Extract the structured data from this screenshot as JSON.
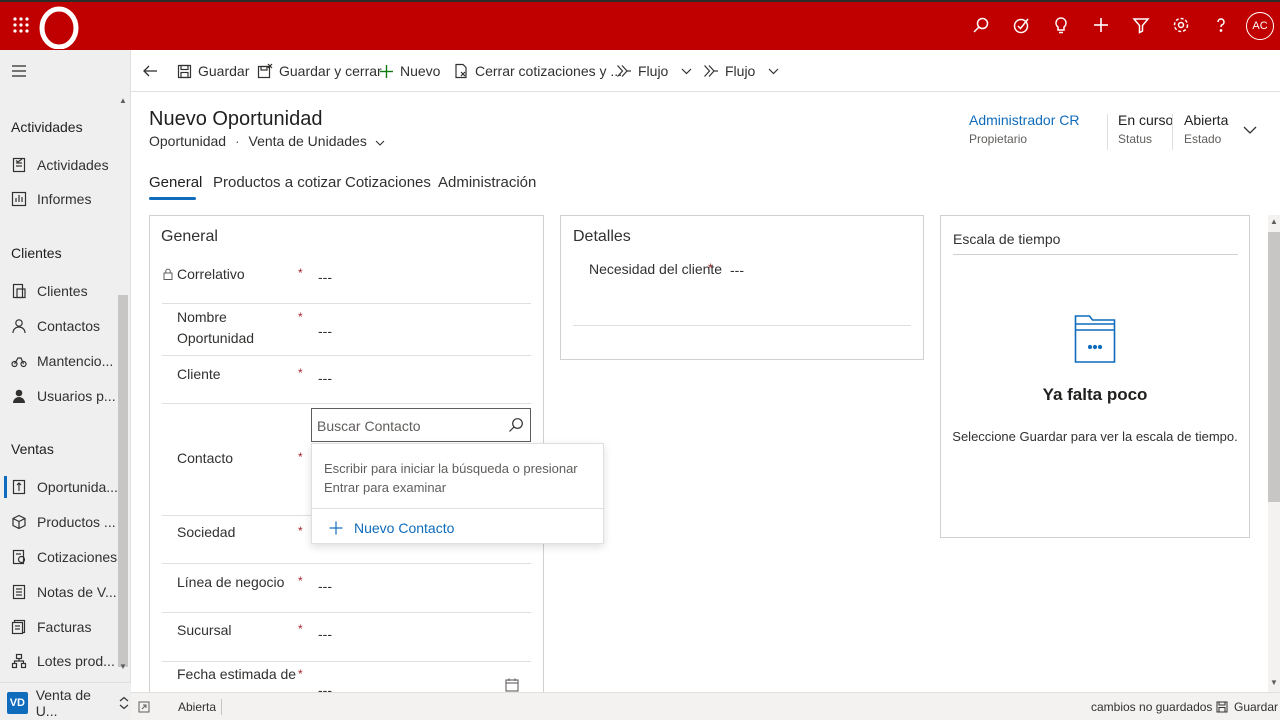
{
  "topbar": {
    "bg": "#c00000",
    "icons": [
      "search-icon",
      "task-icon",
      "lightbulb-icon",
      "plus-icon",
      "filter-icon",
      "gear-icon",
      "help-icon"
    ],
    "avatar_initials": "AC"
  },
  "nav": {
    "groups": [
      {
        "title": "Actividades",
        "items": [
          {
            "label": "Actividades",
            "icon": "activities-icon"
          },
          {
            "label": "Informes",
            "icon": "reports-icon"
          }
        ]
      },
      {
        "title": "Clientes",
        "items": [
          {
            "label": "Clientes",
            "icon": "accounts-icon"
          },
          {
            "label": "Contactos",
            "icon": "contacts-icon"
          },
          {
            "label": "Mantencio...",
            "icon": "maintenance-icon"
          },
          {
            "label": "Usuarios p...",
            "icon": "user-icon"
          }
        ]
      },
      {
        "title": "Ventas",
        "items": [
          {
            "label": "Oportunida...",
            "icon": "opportunity-icon",
            "active": true
          },
          {
            "label": "Productos ...",
            "icon": "products-icon"
          },
          {
            "label": "Cotizaciones",
            "icon": "quotes-icon"
          },
          {
            "label": "Notas de V...",
            "icon": "sales-notes-icon"
          },
          {
            "label": "Facturas",
            "icon": "invoices-icon"
          },
          {
            "label": "Lotes prod...",
            "icon": "batches-icon"
          }
        ]
      }
    ],
    "area": {
      "badge": "VD",
      "label": "Venta de U..."
    }
  },
  "commandbar": {
    "save": "Guardar",
    "save_close": "Guardar y cerrar",
    "new": "Nuevo",
    "close_quotes": "Cerrar cotizaciones y ...",
    "flow1": "Flujo",
    "flow2": "Flujo"
  },
  "record": {
    "title": "Nuevo Oportunidad",
    "entity": "Oportunidad",
    "form": "Venta de Unidades",
    "owner": {
      "value": "Administrador CR",
      "label": "Propietario"
    },
    "status": {
      "value": "En curso",
      "label": "Status"
    },
    "state": {
      "value": "Abierta",
      "label": "Estado"
    }
  },
  "tabs": [
    "General",
    "Productos a cotizar",
    "Cotizaciones",
    "Administración"
  ],
  "general": {
    "title": "General",
    "fields": [
      {
        "label": "Correlativo",
        "value": "---",
        "required": "*"
      },
      {
        "label": "Nombre Oportunidad",
        "value": "---",
        "required": "*"
      },
      {
        "label": "Cliente",
        "value": "---",
        "required": "*"
      },
      {
        "label": "Contacto",
        "value": "",
        "required": "*"
      },
      {
        "label": "Sociedad",
        "value": "",
        "required": "*"
      },
      {
        "label": "Línea de negocio",
        "value": "---",
        "required": "*"
      },
      {
        "label": "Sucursal",
        "value": "---",
        "required": "*"
      },
      {
        "label": "Fecha estimada de",
        "value": "---",
        "required": "*"
      }
    ]
  },
  "lookup": {
    "placeholder": "Buscar Contacto",
    "hint": "Escribir para iniciar la búsqueda o presionar Entrar para examinar",
    "new_label": "Nuevo Contacto"
  },
  "details": {
    "title": "Detalles",
    "fields": [
      {
        "label": "Necesidad del cliente",
        "value": "---",
        "required": "*"
      }
    ]
  },
  "timeline": {
    "title": "Escala de tiempo",
    "empty_title": "Ya falta poco",
    "empty_text": "Seleccione Guardar para ver la escala de tiempo."
  },
  "statusbar": {
    "state": "Abierta",
    "unsaved": "cambios no guardados",
    "save": "Guardar"
  }
}
